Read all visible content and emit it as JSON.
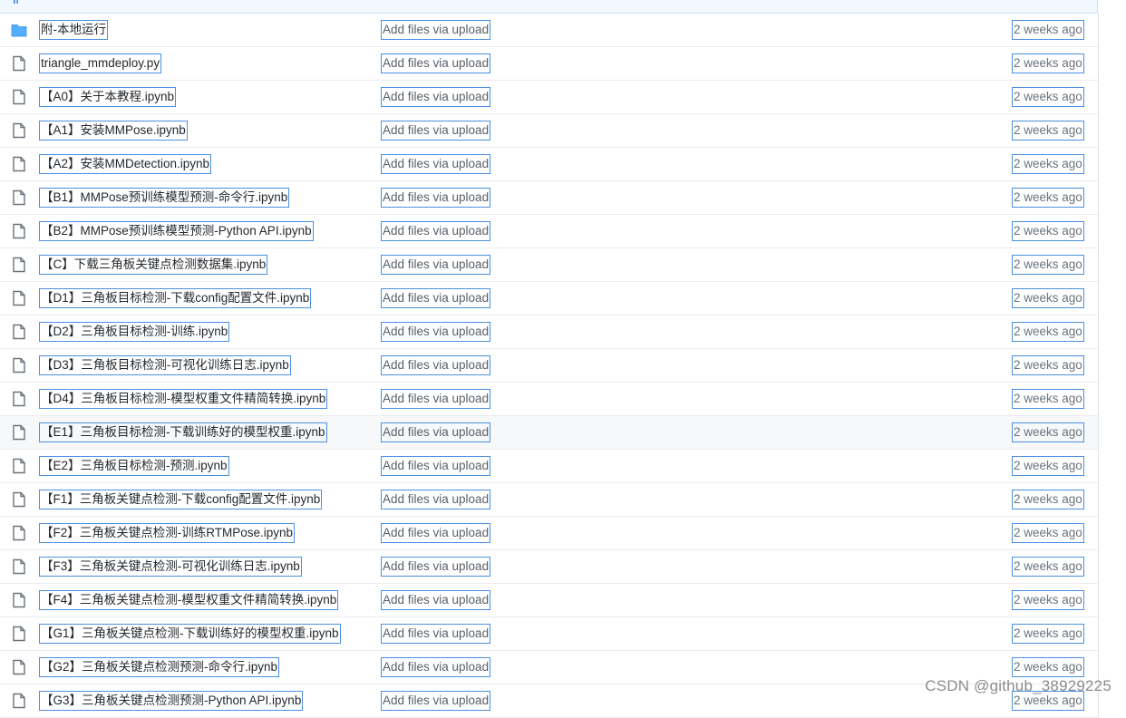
{
  "topbar": {
    "fragment": "Ir"
  },
  "files": [
    {
      "type": "folder",
      "name": "附-本地运行",
      "message": "Add files via upload",
      "age": "2 weeks ago"
    },
    {
      "type": "file",
      "name": "triangle_mmdeploy.py",
      "message": "Add files via upload",
      "age": "2 weeks ago"
    },
    {
      "type": "file",
      "name": "【A0】关于本教程.ipynb",
      "message": "Add files via upload",
      "age": "2 weeks ago"
    },
    {
      "type": "file",
      "name": "【A1】安装MMPose.ipynb",
      "message": "Add files via upload",
      "age": "2 weeks ago"
    },
    {
      "type": "file",
      "name": "【A2】安装MMDetection.ipynb",
      "message": "Add files via upload",
      "age": "2 weeks ago"
    },
    {
      "type": "file",
      "name": "【B1】MMPose预训练模型预测-命令行.ipynb",
      "message": "Add files via upload",
      "age": "2 weeks ago"
    },
    {
      "type": "file",
      "name": "【B2】MMPose预训练模型预测-Python API.ipynb",
      "message": "Add files via upload",
      "age": "2 weeks ago"
    },
    {
      "type": "file",
      "name": "【C】下载三角板关键点检测数据集.ipynb",
      "message": "Add files via upload",
      "age": "2 weeks ago"
    },
    {
      "type": "file",
      "name": "【D1】三角板目标检测-下载config配置文件.ipynb",
      "message": "Add files via upload",
      "age": "2 weeks ago"
    },
    {
      "type": "file",
      "name": "【D2】三角板目标检测-训练.ipynb",
      "message": "Add files via upload",
      "age": "2 weeks ago"
    },
    {
      "type": "file",
      "name": "【D3】三角板目标检测-可视化训练日志.ipynb",
      "message": "Add files via upload",
      "age": "2 weeks ago"
    },
    {
      "type": "file",
      "name": "【D4】三角板目标检测-模型权重文件精简转换.ipynb",
      "message": "Add files via upload",
      "age": "2 weeks ago"
    },
    {
      "type": "file",
      "name": "【E1】三角板目标检测-下载训练好的模型权重.ipynb",
      "message": "Add files via upload",
      "age": "2 weeks ago",
      "highlight": true
    },
    {
      "type": "file",
      "name": "【E2】三角板目标检测-预测.ipynb",
      "message": "Add files via upload",
      "age": "2 weeks ago"
    },
    {
      "type": "file",
      "name": "【F1】三角板关键点检测-下载config配置文件.ipynb",
      "message": "Add files via upload",
      "age": "2 weeks ago"
    },
    {
      "type": "file",
      "name": "【F2】三角板关键点检测-训练RTMPose.ipynb",
      "message": "Add files via upload",
      "age": "2 weeks ago"
    },
    {
      "type": "file",
      "name": "【F3】三角板关键点检测-可视化训练日志.ipynb",
      "message": "Add files via upload",
      "age": "2 weeks ago"
    },
    {
      "type": "file",
      "name": "【F4】三角板关键点检测-模型权重文件精简转换.ipynb",
      "message": "Add files via upload",
      "age": "2 weeks ago"
    },
    {
      "type": "file",
      "name": "【G1】三角板关键点检测-下载训练好的模型权重.ipynb",
      "message": "Add files via upload",
      "age": "2 weeks ago"
    },
    {
      "type": "file",
      "name": "【G2】三角板关键点检测预测-命令行.ipynb",
      "message": "Add files via upload",
      "age": "2 weeks ago"
    },
    {
      "type": "file",
      "name": "【G3】三角板关键点检测预测-Python API.ipynb",
      "message": "Add files via upload",
      "age": "2 weeks ago"
    }
  ],
  "watermark": "CSDN @github_38929225",
  "colors": {
    "folder": "#54aeff",
    "file_icon": "#6a737d",
    "link_border": "#4a90e2"
  }
}
